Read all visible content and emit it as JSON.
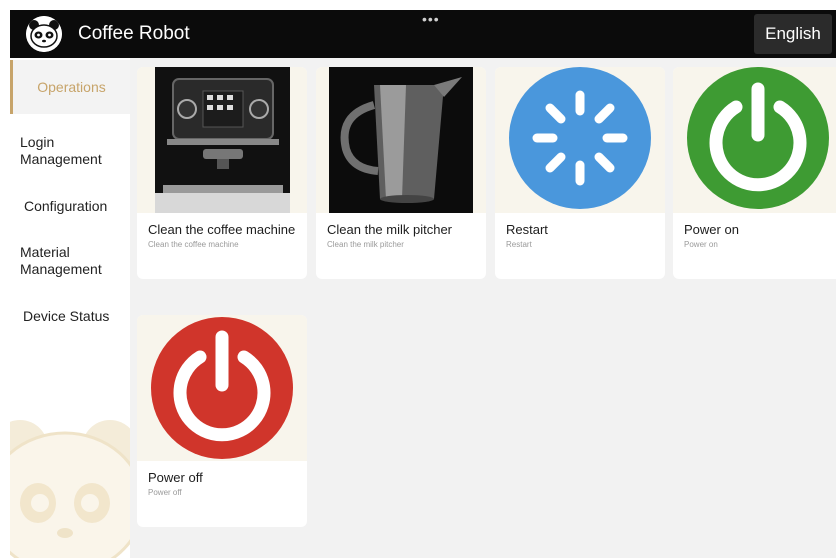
{
  "header": {
    "title": "Coffee Robot",
    "more_glyph": "•••",
    "language_button": "English",
    "status_icons": "≋ ▭",
    "logo_icon": "panda-logo-icon",
    "bar_color": "#0b0b0b"
  },
  "sidebar": {
    "items": [
      {
        "label": "Operations",
        "active": true
      },
      {
        "label": "Login Management",
        "active": false
      },
      {
        "label": "Configuration",
        "active": false
      },
      {
        "label": "Material Management",
        "active": false
      },
      {
        "label": "Device Status",
        "active": false
      }
    ],
    "accent_color": "#c7a46a"
  },
  "operations": [
    {
      "title": "Clean the coffee machine",
      "subtitle": "Clean the coffee machine",
      "icon": "coffee-machine-image"
    },
    {
      "title": "Clean the milk pitcher",
      "subtitle": "Clean the milk pitcher",
      "icon": "milk-pitcher-image"
    },
    {
      "title": "Restart",
      "subtitle": "Restart",
      "icon": "restart-spinner-icon",
      "color": "#4a97dc"
    },
    {
      "title": "Power on",
      "subtitle": "Power on",
      "icon": "power-on-icon",
      "color": "#3e9b33"
    },
    {
      "title": "Power off",
      "subtitle": "Power off",
      "icon": "power-off-icon",
      "color": "#d0352b"
    }
  ]
}
